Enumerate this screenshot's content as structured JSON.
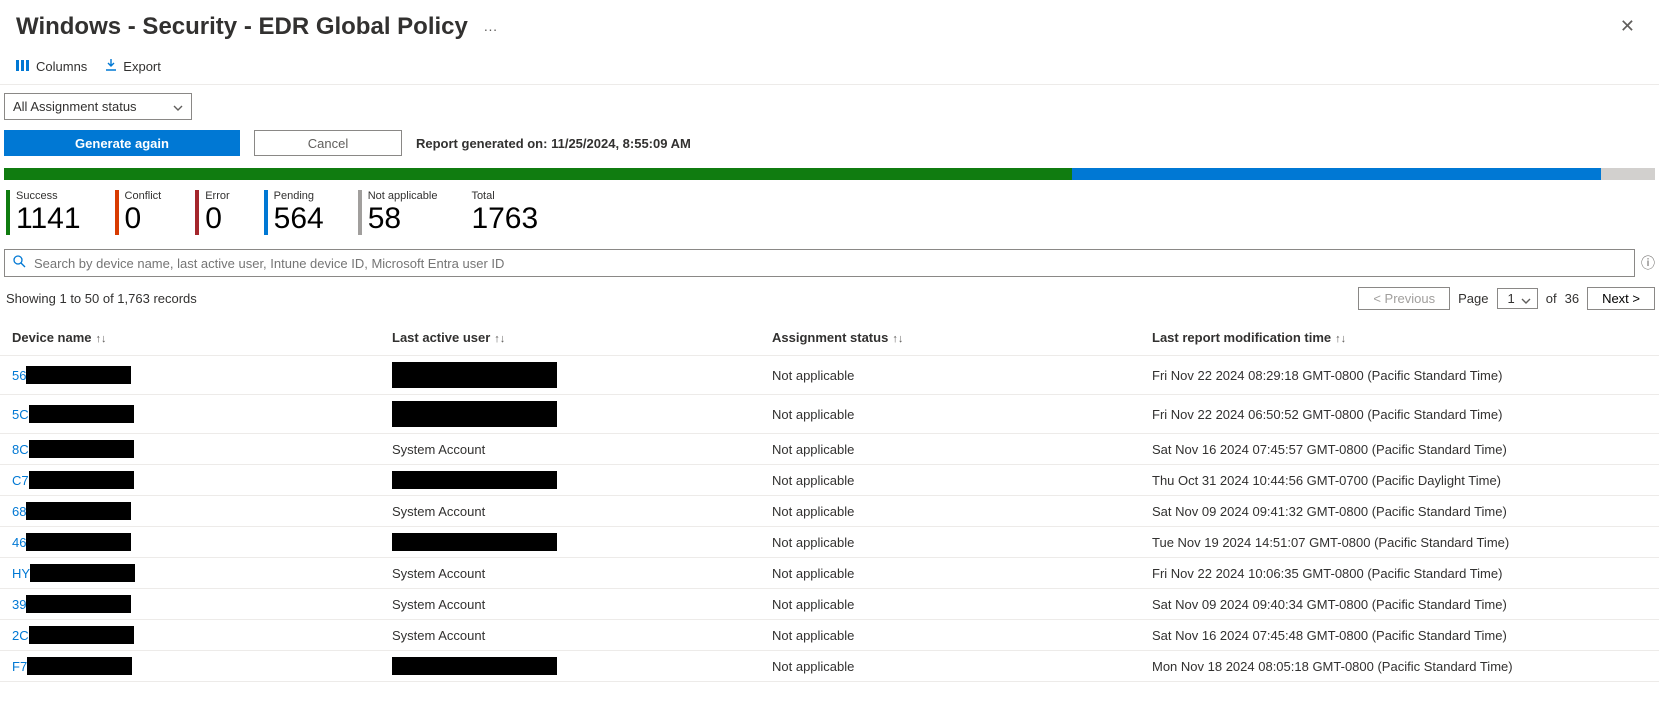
{
  "header": {
    "title": "Windows - Security - EDR Global Policy",
    "more_actions": "···",
    "close_label": "✕"
  },
  "toolbar": {
    "columns_label": "Columns",
    "export_label": "Export"
  },
  "filter": {
    "assignment_status_selected": "All Assignment status"
  },
  "actions": {
    "generate_label": "Generate again",
    "cancel_label": "Cancel",
    "report_ts_label": "Report generated on:",
    "report_ts_value": "11/25/2024, 8:55:09 AM"
  },
  "progress": {
    "green_pct": 64.7,
    "blue_pct": 32.0,
    "grey_pct": 3.3
  },
  "stats": {
    "success": {
      "label": "Success",
      "value": "1141"
    },
    "conflict": {
      "label": "Conflict",
      "value": "0"
    },
    "error": {
      "label": "Error",
      "value": "0"
    },
    "pending": {
      "label": "Pending",
      "value": "564"
    },
    "na": {
      "label": "Not applicable",
      "value": "58"
    },
    "total": {
      "label": "Total",
      "value": "1763"
    }
  },
  "search": {
    "placeholder": "Search by device name, last active user, Intune device ID, Microsoft Entra user ID"
  },
  "pager": {
    "showing_text": "Showing 1 to 50 of 1,763 records",
    "prev_label": "< Previous",
    "page_word": "Page",
    "page_value": "1",
    "of_word": "of",
    "total_pages": "36",
    "next_label": "Next >"
  },
  "columns": {
    "device": "Device name",
    "user": "Last active user",
    "assign": "Assignment status",
    "time": "Last report modification time"
  },
  "rows": [
    {
      "device_prefix": "56",
      "device_redact_w": 105,
      "user_text": "",
      "user_redact_w": 165,
      "user_redact_tall": true,
      "assign": "Not applicable",
      "time": "Fri Nov 22 2024 08:29:18 GMT-0800 (Pacific Standard Time)"
    },
    {
      "device_prefix": "5C",
      "device_redact_w": 105,
      "user_text": "",
      "user_redact_w": 165,
      "user_redact_tall": true,
      "assign": "Not applicable",
      "time": "Fri Nov 22 2024 06:50:52 GMT-0800 (Pacific Standard Time)"
    },
    {
      "device_prefix": "8C",
      "device_redact_w": 105,
      "user_text": "System Account",
      "user_redact_w": 0,
      "assign": "Not applicable",
      "time": "Sat Nov 16 2024 07:45:57 GMT-0800 (Pacific Standard Time)"
    },
    {
      "device_prefix": "C7",
      "device_redact_w": 105,
      "user_text": "",
      "user_redact_w": 165,
      "assign": "Not applicable",
      "time": "Thu Oct 31 2024 10:44:56 GMT-0700 (Pacific Daylight Time)"
    },
    {
      "device_prefix": "68",
      "device_redact_w": 105,
      "user_text": "System Account",
      "user_redact_w": 0,
      "assign": "Not applicable",
      "time": "Sat Nov 09 2024 09:41:32 GMT-0800 (Pacific Standard Time)"
    },
    {
      "device_prefix": "46",
      "device_redact_w": 105,
      "user_text": "",
      "user_redact_w": 165,
      "assign": "Not applicable",
      "time": "Tue Nov 19 2024 14:51:07 GMT-0800 (Pacific Standard Time)"
    },
    {
      "device_prefix": "HY",
      "device_redact_w": 105,
      "user_text": "System Account",
      "user_redact_w": 0,
      "assign": "Not applicable",
      "time": "Fri Nov 22 2024 10:06:35 GMT-0800 (Pacific Standard Time)"
    },
    {
      "device_prefix": "39",
      "device_redact_w": 105,
      "user_text": "System Account",
      "user_redact_w": 0,
      "assign": "Not applicable",
      "time": "Sat Nov 09 2024 09:40:34 GMT-0800 (Pacific Standard Time)"
    },
    {
      "device_prefix": "2C",
      "device_redact_w": 105,
      "user_text": "System Account",
      "user_redact_w": 0,
      "assign": "Not applicable",
      "time": "Sat Nov 16 2024 07:45:48 GMT-0800 (Pacific Standard Time)"
    },
    {
      "device_prefix": "F7",
      "device_redact_w": 105,
      "user_text": "",
      "user_redact_w": 165,
      "assign": "Not applicable",
      "time": "Mon Nov 18 2024 08:05:18 GMT-0800 (Pacific Standard Time)"
    }
  ]
}
